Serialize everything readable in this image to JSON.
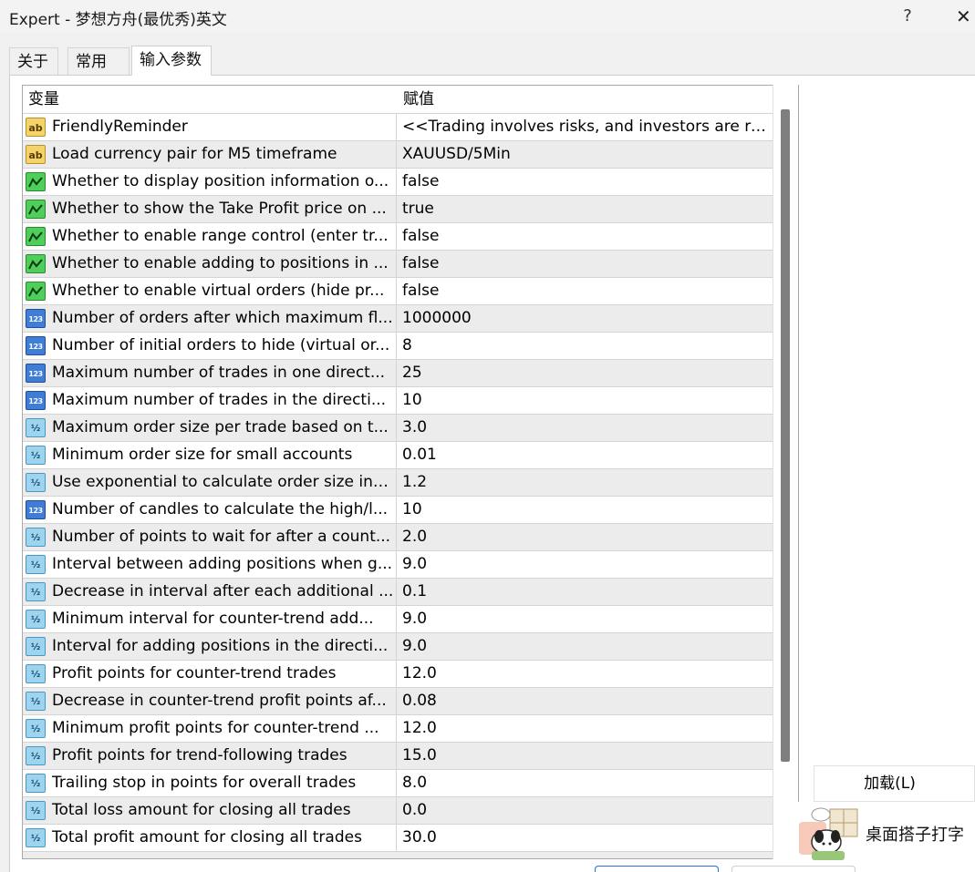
{
  "window": {
    "title": "Expert - 梦想方舟(最优秀)英文",
    "help_label": "?",
    "close_label": "✕"
  },
  "tabs": [
    {
      "label": "关于"
    },
    {
      "label": "常用"
    },
    {
      "label": "输入参数",
      "active": true
    }
  ],
  "grid": {
    "columns": [
      "变量",
      "赋值"
    ],
    "rows": [
      {
        "type": "string",
        "name": "FriendlyReminder",
        "value": "<<Trading involves risks, and investors are re..."
      },
      {
        "type": "string",
        "name": "Load currency pair for M5 timeframe",
        "value": "XAUUSD/5Min"
      },
      {
        "type": "bool",
        "name": "Whether to display position information o...",
        "value": "false"
      },
      {
        "type": "bool",
        "name": "Whether to show the Take Profit price on ...",
        "value": "true"
      },
      {
        "type": "bool",
        "name": "Whether to enable range control (enter tr...",
        "value": "false"
      },
      {
        "type": "bool",
        "name": "Whether to enable adding to positions in ...",
        "value": "false"
      },
      {
        "type": "bool",
        "name": "Whether to enable virtual orders (hide pr...",
        "value": "false"
      },
      {
        "type": "int",
        "name": "Number of orders after which maximum fl...",
        "value": "1000000"
      },
      {
        "type": "int",
        "name": "Number of initial orders to hide (virtual or...",
        "value": "8"
      },
      {
        "type": "int",
        "name": "Maximum number of trades in one direct...",
        "value": "25"
      },
      {
        "type": "int",
        "name": "Maximum number of trades in the directi...",
        "value": "10"
      },
      {
        "type": "double",
        "name": "Maximum order size per trade based on t...",
        "value": "3.0"
      },
      {
        "type": "double",
        "name": "Minimum order size for small accounts",
        "value": "0.01"
      },
      {
        "type": "double",
        "name": "Use exponential to calculate order size inc...",
        "value": "1.2"
      },
      {
        "type": "int",
        "name": "Number of candles to calculate the high/l...",
        "value": "10"
      },
      {
        "type": "double",
        "name": "Number of points to wait for after a count...",
        "value": "2.0"
      },
      {
        "type": "double",
        "name": "Interval between adding positions when g...",
        "value": "9.0"
      },
      {
        "type": "double",
        "name": "Decrease in interval after each additional ...",
        "value": "0.1"
      },
      {
        "type": "double",
        "name": "Minimum interval for counter-trend add...",
        "value": "9.0"
      },
      {
        "type": "double",
        "name": "Interval for adding positions in the directi...",
        "value": "9.0"
      },
      {
        "type": "double",
        "name": "Profit points for counter-trend trades",
        "value": "12.0"
      },
      {
        "type": "double",
        "name": "Decrease in counter-trend profit points af...",
        "value": "0.08"
      },
      {
        "type": "double",
        "name": "Minimum profit points for counter-trend ...",
        "value": "12.0"
      },
      {
        "type": "double",
        "name": "Profit points for trend-following trades",
        "value": "15.0"
      },
      {
        "type": "double",
        "name": "Trailing stop in points for overall trades",
        "value": "8.0"
      },
      {
        "type": "double",
        "name": "Total loss amount for closing all trades",
        "value": "0.0"
      },
      {
        "type": "double",
        "name": "Total profit amount for closing all trades",
        "value": "30.0"
      }
    ]
  },
  "icons": {
    "string": {
      "name": "string-type-icon",
      "glyph": "ab",
      "color": "#f3d36a"
    },
    "bool": {
      "name": "bool-type-icon",
      "color": "#4fcf5a"
    },
    "int": {
      "name": "integer-type-icon",
      "glyph": "123",
      "color": "#3f7dd6"
    },
    "double": {
      "name": "double-type-icon",
      "glyph": "½",
      "color": "#9fd4ef"
    }
  },
  "buttons": {
    "load_label": "加载(L)"
  },
  "ime": {
    "label": "桌面搭子打字"
  }
}
